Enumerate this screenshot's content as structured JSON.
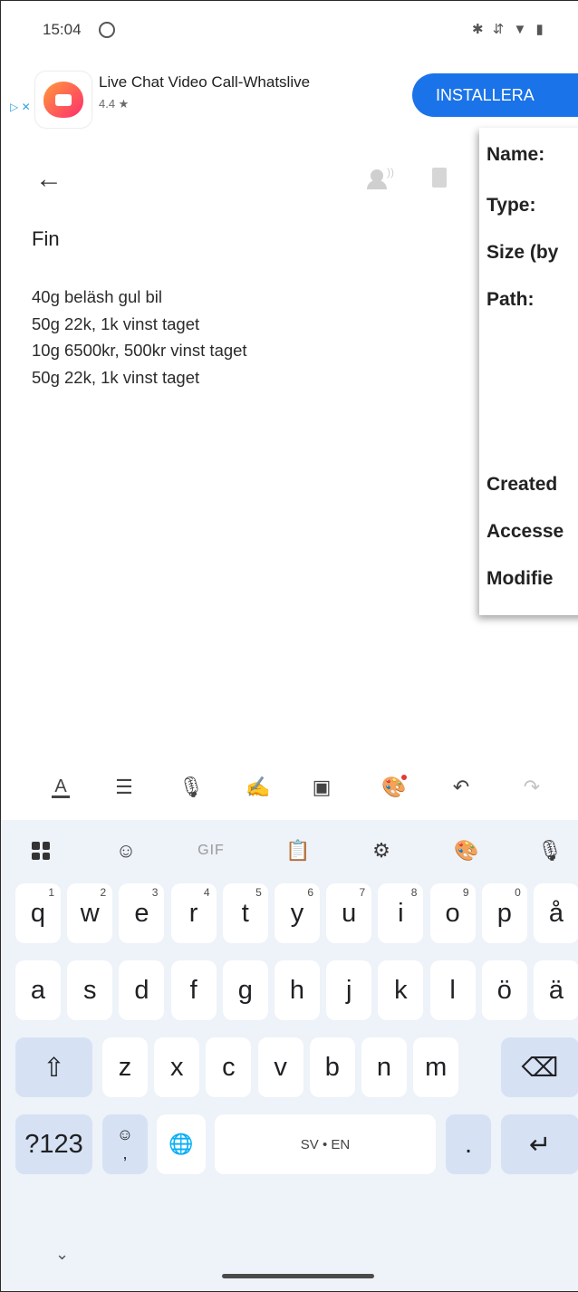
{
  "status": {
    "time": "15:04",
    "icons": "✱ ⇵ ▼ ▮"
  },
  "ad": {
    "adchoices": "▷ ✕",
    "app_name": "Live Chat Video Call-Whatslive",
    "rating": "4.4 ★",
    "install": "INSTALLERA"
  },
  "note": {
    "back": "←",
    "title": "Fin",
    "lines": [
      "40g beläsh gul bil",
      "50g 22k, 1k vinst taget",
      "10g 6500kr, 500kr vinst taget",
      "50g 22k, 1k vinst taget"
    ]
  },
  "properties": {
    "name": "Name:",
    "type": "Type:",
    "size": "Size (by",
    "path": "Path:",
    "created": "Created",
    "accessed": "Accesse",
    "modified": "Modifie"
  },
  "format_toolbar": {
    "text_format": "A",
    "checklist": "☰",
    "mic": "🎙",
    "draw": "✍",
    "image": "▣",
    "palette": "🎨",
    "undo": "↶",
    "redo": "↷"
  },
  "keyboard": {
    "top_row": {
      "gif": "GIF",
      "clipboard": "📋",
      "settings": "⚙",
      "theme": "🎨",
      "mic": "🎙",
      "sticker": "☺",
      "apps": "apps"
    },
    "row1": [
      {
        "k": "q",
        "s": "1"
      },
      {
        "k": "w",
        "s": "2"
      },
      {
        "k": "e",
        "s": "3"
      },
      {
        "k": "r",
        "s": "4"
      },
      {
        "k": "t",
        "s": "5"
      },
      {
        "k": "y",
        "s": "6"
      },
      {
        "k": "u",
        "s": "7"
      },
      {
        "k": "i",
        "s": "8"
      },
      {
        "k": "o",
        "s": "9"
      },
      {
        "k": "p",
        "s": "0"
      },
      {
        "k": "å",
        "s": ""
      }
    ],
    "row2": [
      "a",
      "s",
      "d",
      "f",
      "g",
      "h",
      "j",
      "k",
      "l",
      "ö",
      "ä"
    ],
    "row3": [
      "z",
      "x",
      "c",
      "v",
      "b",
      "n",
      "m"
    ],
    "shift": "⇧",
    "backspace": "⌫",
    "symbols": "?123",
    "emoji": "☺",
    "comma": ",",
    "globe": "🌐",
    "space": "SV • EN",
    "period": ".",
    "enter": "↵",
    "hide": "⌄"
  }
}
